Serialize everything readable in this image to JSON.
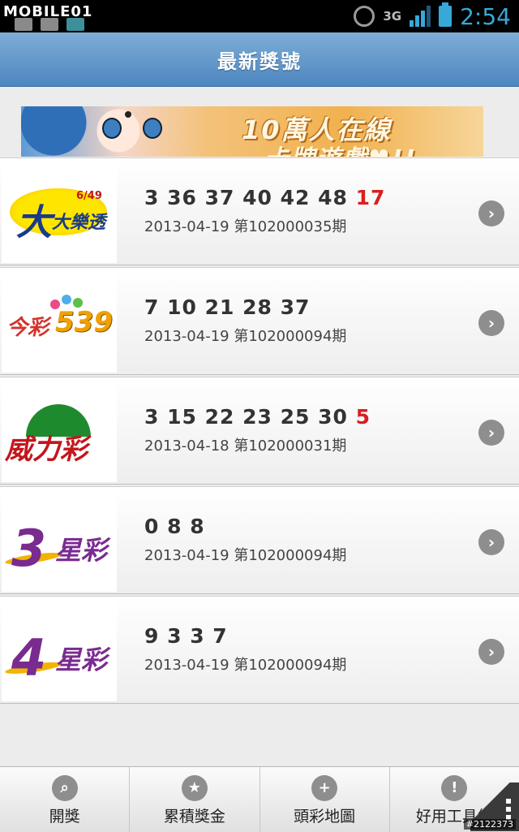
{
  "status_bar": {
    "watermark_logo": "MOBILE01",
    "network": "3G",
    "time": "2:54",
    "signal_level": 0.75,
    "accent_color": "#37a8d8"
  },
  "header": {
    "title": "最新獎號"
  },
  "banner": {
    "headline": "10萬人在線",
    "subline": "卡牌遊戲♥!!"
  },
  "lotteries": [
    {
      "logo": {
        "name": "大樂透",
        "badge": "6/49"
      },
      "numbers": "3 36 37 40 42 48",
      "special": "17",
      "draw": "2013-04-19 第102000035期"
    },
    {
      "logo": {
        "name": "今彩",
        "badge": "539"
      },
      "numbers": "7 10 21 28 37",
      "special": "",
      "draw": "2013-04-19 第102000094期"
    },
    {
      "logo": {
        "name": "威力彩",
        "badge": ""
      },
      "numbers": "3 15 22 23 25 30",
      "special": "5",
      "draw": "2013-04-18 第102000031期"
    },
    {
      "logo": {
        "name": "星彩",
        "badge": "3"
      },
      "numbers": "0 8 8",
      "special": "",
      "draw": "2013-04-19 第102000094期"
    },
    {
      "logo": {
        "name": "星彩",
        "badge": "4"
      },
      "numbers": "9 3 3 7",
      "special": "",
      "draw": "2013-04-19 第102000094期"
    }
  ],
  "tabs": [
    {
      "label": "開獎",
      "icon": "search-icon",
      "glyph": "⌕"
    },
    {
      "label": "累積獎金",
      "icon": "star-icon",
      "glyph": "★"
    },
    {
      "label": "頭彩地圖",
      "icon": "plus-icon",
      "glyph": "+"
    },
    {
      "label": "好用工具組",
      "icon": "warning-icon",
      "glyph": "!"
    }
  ],
  "special_number_color": "#d8201f",
  "watermark_id": "#2122373"
}
